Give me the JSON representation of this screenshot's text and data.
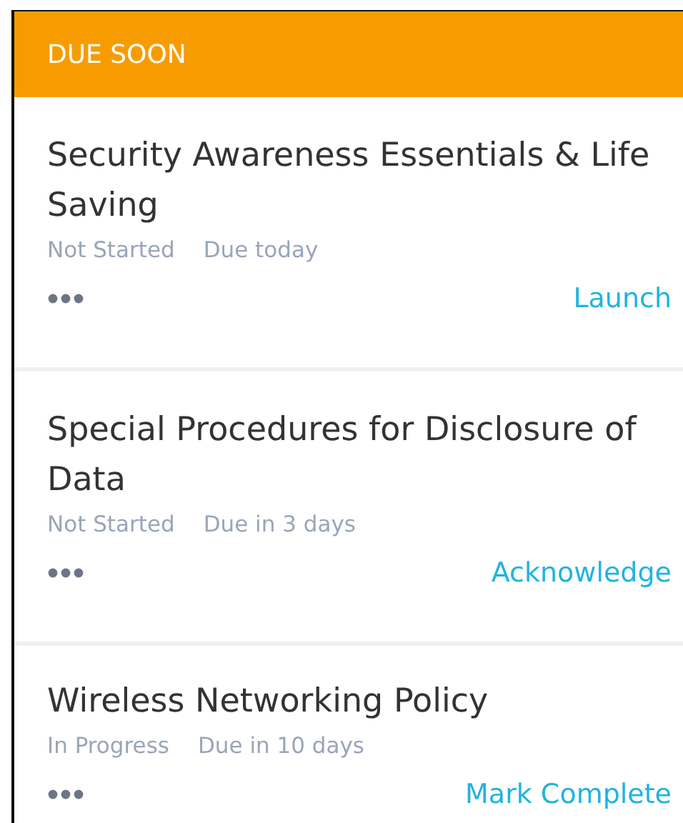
{
  "header": {
    "title": "DUE SOON"
  },
  "items": [
    {
      "title": "Security Awareness Essentials & Life Saving",
      "status": "Not Started",
      "due": "Due today",
      "action": "Launch"
    },
    {
      "title": "Special Procedures for Disclosure of Data",
      "status": "Not Started",
      "due": "Due in 3 days",
      "action": "Acknowledge"
    },
    {
      "title": "Wireless Networking Policy",
      "status": "In Progress",
      "due": "Due in 10 days",
      "action": "Mark Complete"
    }
  ]
}
